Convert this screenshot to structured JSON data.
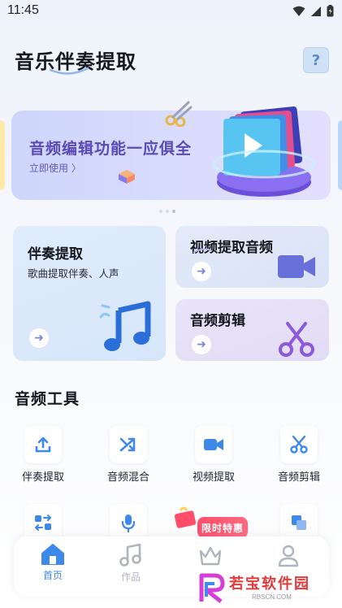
{
  "status_bar": {
    "time": "11:45"
  },
  "header": {
    "title": "音乐伴奏提取",
    "help_label": "?"
  },
  "banner": {
    "title": "音频编辑功能一应俱全",
    "subtitle": "立即使用 〉",
    "dots": 3,
    "active_dot": 2
  },
  "feature_cards": {
    "accomp": {
      "title": "伴奏提取",
      "desc": "歌曲提取伴奏、人声",
      "arrow": "➜"
    },
    "video": {
      "title": "视频提取音频",
      "arrow": "➜"
    },
    "cut": {
      "title": "音频剪辑",
      "arrow": "➜"
    }
  },
  "tools_section": {
    "title": "音频工具",
    "tools": [
      {
        "label": "伴奏提取",
        "icon": "upload-icon"
      },
      {
        "label": "音频混合",
        "icon": "shuffle-icon"
      },
      {
        "label": "视频提取",
        "icon": "video-camera-icon"
      },
      {
        "label": "音频剪辑",
        "icon": "scissors-icon"
      }
    ]
  },
  "promo_badge": "限时特惠",
  "tabbar": {
    "tabs": [
      {
        "label": "首页",
        "icon": "home-icon",
        "active": true
      },
      {
        "label": "作品",
        "icon": "music-note-icon",
        "active": false
      },
      {
        "label": "",
        "icon": "crown-icon",
        "active": false
      },
      {
        "label": "",
        "icon": "user-icon",
        "active": false
      }
    ]
  },
  "watermark": {
    "text": "若宝软件园",
    "url": "RBSCN.COM"
  },
  "colors": {
    "accent": "#3e88ea",
    "banner_text": "#5b4ab5",
    "promo": "#ff4d6a"
  }
}
